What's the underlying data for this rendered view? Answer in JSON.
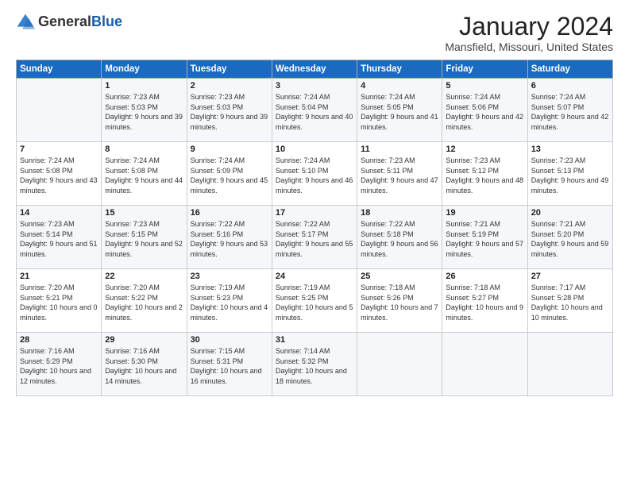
{
  "header": {
    "logo_general": "General",
    "logo_blue": "Blue",
    "title": "January 2024",
    "location": "Mansfield, Missouri, United States"
  },
  "weekdays": [
    "Sunday",
    "Monday",
    "Tuesday",
    "Wednesday",
    "Thursday",
    "Friday",
    "Saturday"
  ],
  "weeks": [
    [
      {
        "day": "",
        "sunrise": "",
        "sunset": "",
        "daylight": ""
      },
      {
        "day": "1",
        "sunrise": "Sunrise: 7:23 AM",
        "sunset": "Sunset: 5:03 PM",
        "daylight": "Daylight: 9 hours and 39 minutes."
      },
      {
        "day": "2",
        "sunrise": "Sunrise: 7:23 AM",
        "sunset": "Sunset: 5:03 PM",
        "daylight": "Daylight: 9 hours and 39 minutes."
      },
      {
        "day": "3",
        "sunrise": "Sunrise: 7:24 AM",
        "sunset": "Sunset: 5:04 PM",
        "daylight": "Daylight: 9 hours and 40 minutes."
      },
      {
        "day": "4",
        "sunrise": "Sunrise: 7:24 AM",
        "sunset": "Sunset: 5:05 PM",
        "daylight": "Daylight: 9 hours and 41 minutes."
      },
      {
        "day": "5",
        "sunrise": "Sunrise: 7:24 AM",
        "sunset": "Sunset: 5:06 PM",
        "daylight": "Daylight: 9 hours and 42 minutes."
      },
      {
        "day": "6",
        "sunrise": "Sunrise: 7:24 AM",
        "sunset": "Sunset: 5:07 PM",
        "daylight": "Daylight: 9 hours and 42 minutes."
      }
    ],
    [
      {
        "day": "7",
        "sunrise": "Sunrise: 7:24 AM",
        "sunset": "Sunset: 5:08 PM",
        "daylight": "Daylight: 9 hours and 43 minutes."
      },
      {
        "day": "8",
        "sunrise": "Sunrise: 7:24 AM",
        "sunset": "Sunset: 5:08 PM",
        "daylight": "Daylight: 9 hours and 44 minutes."
      },
      {
        "day": "9",
        "sunrise": "Sunrise: 7:24 AM",
        "sunset": "Sunset: 5:09 PM",
        "daylight": "Daylight: 9 hours and 45 minutes."
      },
      {
        "day": "10",
        "sunrise": "Sunrise: 7:24 AM",
        "sunset": "Sunset: 5:10 PM",
        "daylight": "Daylight: 9 hours and 46 minutes."
      },
      {
        "day": "11",
        "sunrise": "Sunrise: 7:23 AM",
        "sunset": "Sunset: 5:11 PM",
        "daylight": "Daylight: 9 hours and 47 minutes."
      },
      {
        "day": "12",
        "sunrise": "Sunrise: 7:23 AM",
        "sunset": "Sunset: 5:12 PM",
        "daylight": "Daylight: 9 hours and 48 minutes."
      },
      {
        "day": "13",
        "sunrise": "Sunrise: 7:23 AM",
        "sunset": "Sunset: 5:13 PM",
        "daylight": "Daylight: 9 hours and 49 minutes."
      }
    ],
    [
      {
        "day": "14",
        "sunrise": "Sunrise: 7:23 AM",
        "sunset": "Sunset: 5:14 PM",
        "daylight": "Daylight: 9 hours and 51 minutes."
      },
      {
        "day": "15",
        "sunrise": "Sunrise: 7:23 AM",
        "sunset": "Sunset: 5:15 PM",
        "daylight": "Daylight: 9 hours and 52 minutes."
      },
      {
        "day": "16",
        "sunrise": "Sunrise: 7:22 AM",
        "sunset": "Sunset: 5:16 PM",
        "daylight": "Daylight: 9 hours and 53 minutes."
      },
      {
        "day": "17",
        "sunrise": "Sunrise: 7:22 AM",
        "sunset": "Sunset: 5:17 PM",
        "daylight": "Daylight: 9 hours and 55 minutes."
      },
      {
        "day": "18",
        "sunrise": "Sunrise: 7:22 AM",
        "sunset": "Sunset: 5:18 PM",
        "daylight": "Daylight: 9 hours and 56 minutes."
      },
      {
        "day": "19",
        "sunrise": "Sunrise: 7:21 AM",
        "sunset": "Sunset: 5:19 PM",
        "daylight": "Daylight: 9 hours and 57 minutes."
      },
      {
        "day": "20",
        "sunrise": "Sunrise: 7:21 AM",
        "sunset": "Sunset: 5:20 PM",
        "daylight": "Daylight: 9 hours and 59 minutes."
      }
    ],
    [
      {
        "day": "21",
        "sunrise": "Sunrise: 7:20 AM",
        "sunset": "Sunset: 5:21 PM",
        "daylight": "Daylight: 10 hours and 0 minutes."
      },
      {
        "day": "22",
        "sunrise": "Sunrise: 7:20 AM",
        "sunset": "Sunset: 5:22 PM",
        "daylight": "Daylight: 10 hours and 2 minutes."
      },
      {
        "day": "23",
        "sunrise": "Sunrise: 7:19 AM",
        "sunset": "Sunset: 5:23 PM",
        "daylight": "Daylight: 10 hours and 4 minutes."
      },
      {
        "day": "24",
        "sunrise": "Sunrise: 7:19 AM",
        "sunset": "Sunset: 5:25 PM",
        "daylight": "Daylight: 10 hours and 5 minutes."
      },
      {
        "day": "25",
        "sunrise": "Sunrise: 7:18 AM",
        "sunset": "Sunset: 5:26 PM",
        "daylight": "Daylight: 10 hours and 7 minutes."
      },
      {
        "day": "26",
        "sunrise": "Sunrise: 7:18 AM",
        "sunset": "Sunset: 5:27 PM",
        "daylight": "Daylight: 10 hours and 9 minutes."
      },
      {
        "day": "27",
        "sunrise": "Sunrise: 7:17 AM",
        "sunset": "Sunset: 5:28 PM",
        "daylight": "Daylight: 10 hours and 10 minutes."
      }
    ],
    [
      {
        "day": "28",
        "sunrise": "Sunrise: 7:16 AM",
        "sunset": "Sunset: 5:29 PM",
        "daylight": "Daylight: 10 hours and 12 minutes."
      },
      {
        "day": "29",
        "sunrise": "Sunrise: 7:16 AM",
        "sunset": "Sunset: 5:30 PM",
        "daylight": "Daylight: 10 hours and 14 minutes."
      },
      {
        "day": "30",
        "sunrise": "Sunrise: 7:15 AM",
        "sunset": "Sunset: 5:31 PM",
        "daylight": "Daylight: 10 hours and 16 minutes."
      },
      {
        "day": "31",
        "sunrise": "Sunrise: 7:14 AM",
        "sunset": "Sunset: 5:32 PM",
        "daylight": "Daylight: 10 hours and 18 minutes."
      },
      {
        "day": "",
        "sunrise": "",
        "sunset": "",
        "daylight": ""
      },
      {
        "day": "",
        "sunrise": "",
        "sunset": "",
        "daylight": ""
      },
      {
        "day": "",
        "sunrise": "",
        "sunset": "",
        "daylight": ""
      }
    ]
  ]
}
